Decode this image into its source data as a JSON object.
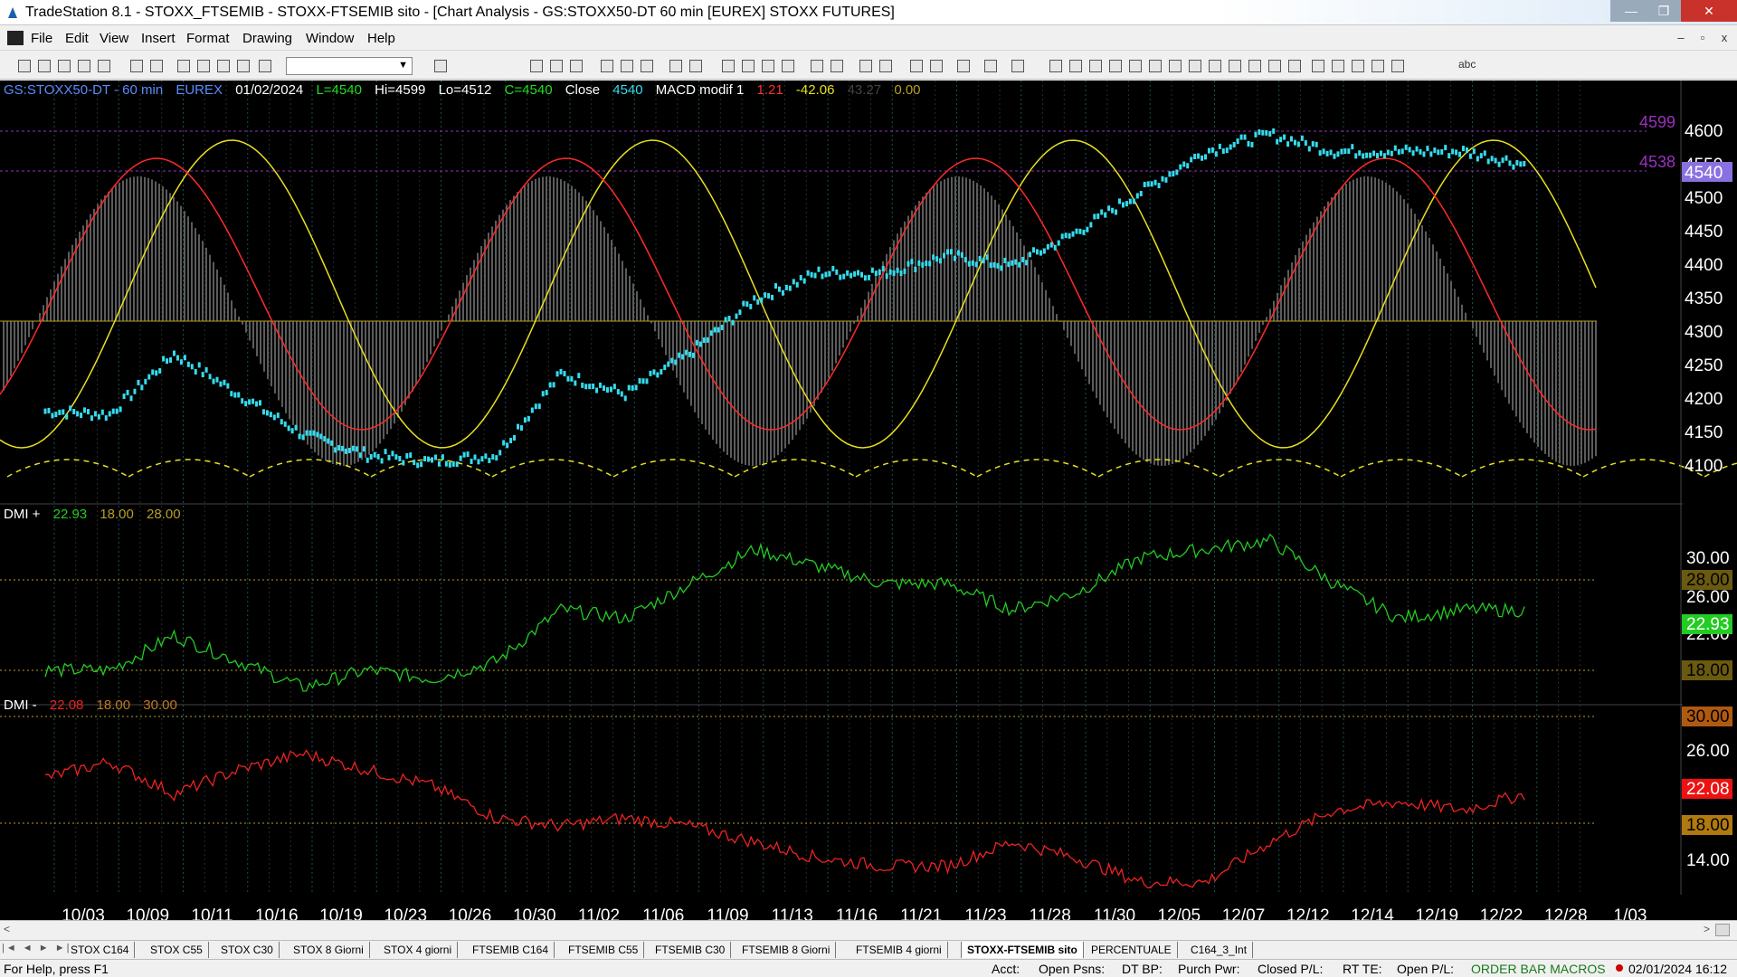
{
  "titlebar": {
    "title": "TradeStation 8.1 - STOXX_FTSEMIB - STOXX-FTSEMIB sito - [Chart Analysis - GS:STOXX50-DT  60 min  [EUREX] STOXX FUTURES]",
    "minimize": "—",
    "maximize": "❐",
    "close": "✕"
  },
  "menu": {
    "items": [
      "File",
      "Edit",
      "View",
      "Insert",
      "Format",
      "Drawing",
      "Window",
      "Help"
    ],
    "mdi_min": "–",
    "mdi_restore": "▫",
    "mdi_close": "x"
  },
  "toolbar": {
    "combo_value": "",
    "abc": "abc"
  },
  "chart": {
    "header": {
      "symbol": "GS:STOXX50-DT - 60 min",
      "exchange": "EUREX",
      "date": "01/02/2024",
      "last": "L=4540",
      "high": "Hi=4599",
      "low": "Lo=4512",
      "close": "C=4540",
      "close_label": "Close",
      "close_val": "4540",
      "macd_label": "MACD modif 1",
      "macd_val": "1.21",
      "macd_avg": "-42.06",
      "macd_diff": "43.27",
      "macd_zero": "0.00"
    },
    "price_axis": [
      "4600",
      "4550",
      "4500",
      "4450",
      "4400",
      "4350",
      "4300",
      "4250",
      "4200",
      "4150",
      "4100"
    ],
    "price_markers": {
      "hi": "4599",
      "lo": "4538",
      "last": "4540"
    },
    "dmi_plus": {
      "label": "DMI +",
      "value": "22.93",
      "lower": "18.00",
      "upper": "28.00",
      "axis": [
        "30.00",
        "26.00",
        "22.00"
      ],
      "markers": {
        "upper": "28.00",
        "value": "22.93",
        "lower": "18.00"
      }
    },
    "dmi_minus": {
      "label": "DMI -",
      "value": "22.08",
      "lower": "18.00",
      "upper": "30.00",
      "axis": [
        "26.00",
        "14.00"
      ],
      "markers": {
        "upper": "30.00",
        "value": "22.08",
        "lower": "18.00"
      }
    },
    "dates": [
      "10/03",
      "10/09",
      "10/11",
      "10/16",
      "10/19",
      "10/23",
      "10/26",
      "10/30",
      "11/02",
      "11/06",
      "11/09",
      "11/13",
      "11/16",
      "11/21",
      "11/23",
      "11/28",
      "11/30",
      "12/05",
      "12/07",
      "12/12",
      "12/14",
      "12/19",
      "12/22",
      "12/28",
      "1/03"
    ],
    "colors": {
      "price": "#33ddee",
      "signal": "#ff2a2a",
      "slow": "#e8e020",
      "histogram": "#6a6a6a",
      "dmi_plus": "#22cc22",
      "dmi_minus": "#ee2222",
      "zero_line": "#b8a020",
      "marker_purple": "#9a30c0"
    }
  },
  "chart_data": [
    {
      "type": "line",
      "title": "GS:STOXX50-DT - 60 min",
      "x": [
        "10/03",
        "10/09",
        "10/11",
        "10/16",
        "10/19",
        "10/23",
        "10/26",
        "10/30",
        "11/02",
        "11/06",
        "11/09",
        "11/13",
        "11/16",
        "11/21",
        "11/23",
        "11/28",
        "11/30",
        "12/05",
        "12/07",
        "12/12",
        "12/14",
        "12/19",
        "12/22",
        "12/28"
      ],
      "series": [
        {
          "name": "Close",
          "values": [
            4175,
            4170,
            4260,
            4200,
            4140,
            4110,
            4100,
            4110,
            4230,
            4200,
            4260,
            4340,
            4380,
            4380,
            4405,
            4390,
            4440,
            4500,
            4560,
            4585,
            4560,
            4560,
            4560,
            4540
          ]
        }
      ],
      "ylim": [
        4075,
        4625
      ]
    },
    {
      "type": "line",
      "title": "DMI +",
      "x": [
        "10/03",
        "10/09",
        "10/11",
        "10/16",
        "10/19",
        "10/23",
        "10/26",
        "10/30",
        "11/02",
        "11/06",
        "11/09",
        "11/13",
        "11/16",
        "11/21",
        "11/23",
        "11/28",
        "11/30",
        "12/05",
        "12/07",
        "12/12",
        "12/14",
        "12/19",
        "12/22",
        "12/28"
      ],
      "series": [
        {
          "name": "DMI +",
          "values": [
            16,
            16,
            20,
            17,
            14,
            16,
            15,
            17,
            23,
            22,
            26,
            30,
            28,
            26,
            26,
            23,
            25,
            29,
            30,
            31,
            26,
            22,
            23,
            22.93
          ]
        }
      ],
      "ylim": [
        12,
        34
      ]
    },
    {
      "type": "line",
      "title": "DMI -",
      "x": [
        "10/03",
        "10/09",
        "10/11",
        "10/16",
        "10/19",
        "10/23",
        "10/26",
        "10/30",
        "11/02",
        "11/06",
        "11/09",
        "11/13",
        "11/16",
        "11/21",
        "11/23",
        "11/28",
        "11/30",
        "12/05",
        "12/07",
        "12/12",
        "12/14",
        "12/19",
        "12/22",
        "12/28"
      ],
      "series": [
        {
          "name": "DMI -",
          "values": [
            24,
            26,
            22,
            25,
            27,
            25,
            23,
            19,
            18,
            19,
            18,
            16,
            14,
            13,
            13,
            16,
            14,
            11,
            11,
            16,
            20,
            21,
            20,
            22.08
          ]
        }
      ],
      "ylim": [
        10,
        32
      ]
    }
  ],
  "tabs": {
    "nav": "|◄ ◄ ► ►|",
    "items": [
      "STOX C164",
      "STOX C55",
      "STOX  C30",
      "STOX  8 Giorni",
      "STOX 4 giorni",
      "FTSEMIB C164",
      "FTSEMIB C55",
      "FTSEMIB C30",
      "FTSEMIB  8 Giorni",
      "FTSEMIB  4 giorni",
      "STOXX-FTSEMIB sito",
      "PERCENTUALE",
      "C164_3_Int"
    ],
    "active_index": 10
  },
  "status": {
    "help": "For Help, press F1",
    "acct": "Acct:",
    "open_psns": "Open Psns:",
    "dt_bp": "DT BP:",
    "purch_pwr": "Purch Pwr:",
    "closed_pl": "Closed P/L:",
    "rt_te": "RT TE:",
    "open_pl": "Open P/L:",
    "orderbar": "ORDER BAR  MACROS",
    "datetime": "02/01/2024 16:12"
  }
}
